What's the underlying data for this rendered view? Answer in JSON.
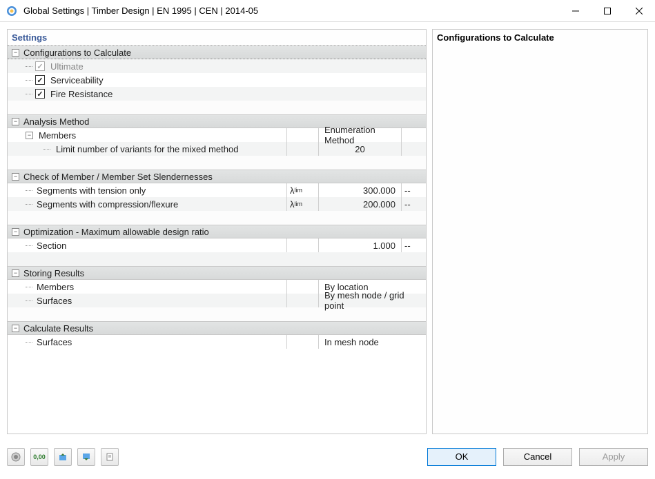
{
  "window": {
    "title": "Global Settings | Timber Design | EN 1995 | CEN | 2014-05"
  },
  "left_header": "Settings",
  "right_header": "Configurations to Calculate",
  "groups": {
    "configurations": {
      "title": "Configurations to Calculate",
      "items": {
        "ultimate": {
          "label": "Ultimate",
          "checked": true,
          "disabled": true
        },
        "serviceability": {
          "label": "Serviceability",
          "checked": true
        },
        "fire": {
          "label": "Fire Resistance",
          "checked": true
        }
      }
    },
    "analysis": {
      "title": "Analysis Method",
      "members_label": "Members",
      "col_header": "Enumeration Method",
      "limit_label": "Limit number of variants for the mixed method",
      "limit_value": "20"
    },
    "slenderness": {
      "title": "Check of Member / Member Set Slendernesses",
      "tension_label": "Segments with tension only",
      "tension_value": "300.000",
      "compression_label": "Segments with compression/flexure",
      "compression_value": "200.000",
      "symbol_html": "λlim",
      "unit": "--"
    },
    "optimization": {
      "title": "Optimization - Maximum allowable design ratio",
      "section_label": "Section",
      "section_value": "1.000",
      "unit": "--"
    },
    "storing": {
      "title": "Storing Results",
      "members_label": "Members",
      "members_value": "By location",
      "surfaces_label": "Surfaces",
      "surfaces_value": "By mesh node / grid point"
    },
    "calculate": {
      "title": "Calculate Results",
      "surfaces_label": "Surfaces",
      "surfaces_value": "In mesh node"
    }
  },
  "footer": {
    "ok": "OK",
    "cancel": "Cancel",
    "apply": "Apply"
  },
  "toolbar_icons": [
    "help",
    "units",
    "import",
    "export",
    "report"
  ]
}
